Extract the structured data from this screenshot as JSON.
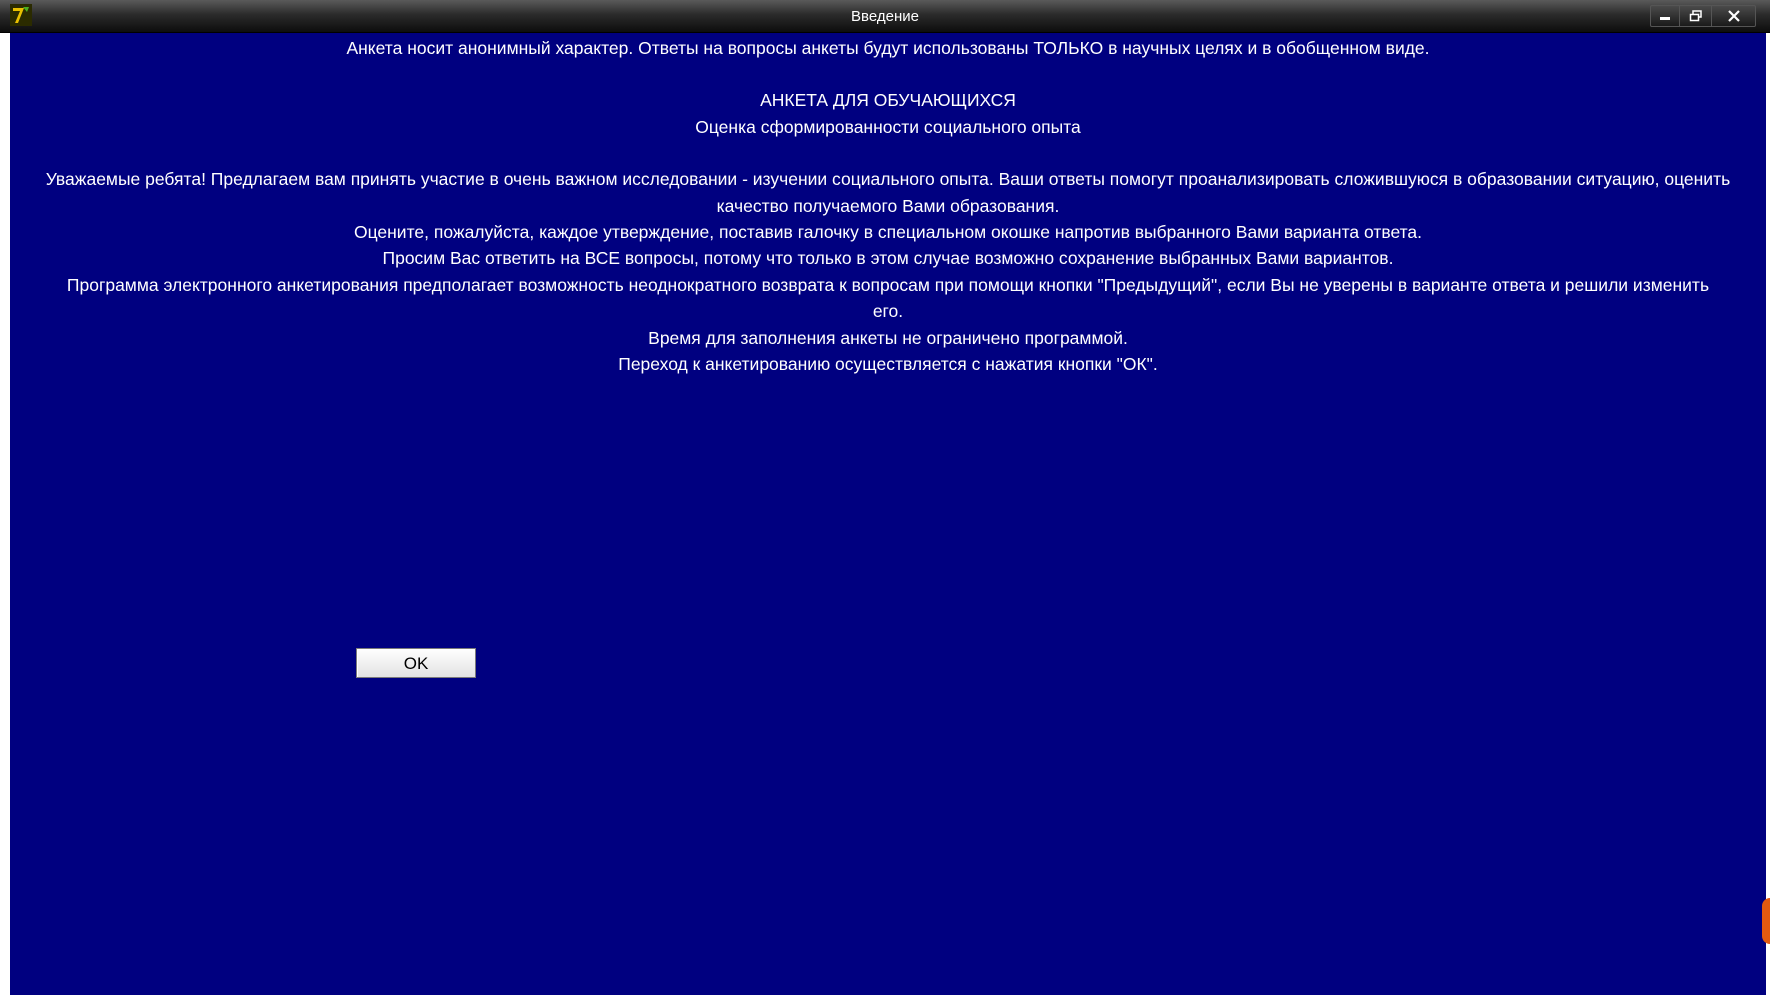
{
  "window": {
    "title": "Введение",
    "app_icon": "seven-logo-icon",
    "controls": [
      "minimize-icon",
      "restore-icon",
      "close-icon"
    ]
  },
  "intro": {
    "line_1": "Анкета носит анонимный характер. Ответы на вопросы анкеты будут использованы ТОЛЬКО в научных целях и в обобщенном виде.",
    "heading": "АНКЕТА ДЛЯ ОБУЧАЮЩИХСЯ",
    "subheading": "Оценка сформированности социального опыта",
    "paragraph_1": "Уважаемые ребята! Предлагаем вам принять участие в очень важном исследовании -  изучении социального опыта. Ваши ответы помогут проанализировать сложившуюся в образовании ситуацию, оценить качество получаемого Вами образования.",
    "paragraph_2": "Оцените, пожалуйста, каждое утверждение, поставив галочку в специальном окошке напротив выбранного Вами варианта ответа.",
    "paragraph_3": "Просим Вас ответить на ВСЕ вопросы, потому что только в этом случае возможно сохранение выбранных Вами вариантов.",
    "paragraph_4": "Программа электронного анкетирования предполагает возможность неоднократного возврата к  вопросам при помощи кнопки \"Предыдущий\", если Вы не уверены в варианте ответа и решили изменить его.",
    "paragraph_5": "Время для заполнения анкеты не ограничено программой.",
    "paragraph_6": "Переход к анкетированию осуществляется с нажатия кнопки \"ОК\"."
  },
  "buttons": {
    "ok_label": "OK"
  },
  "colors": {
    "background": "#000080",
    "text": "#ffffff",
    "titlebar": "#1a1a1a"
  }
}
